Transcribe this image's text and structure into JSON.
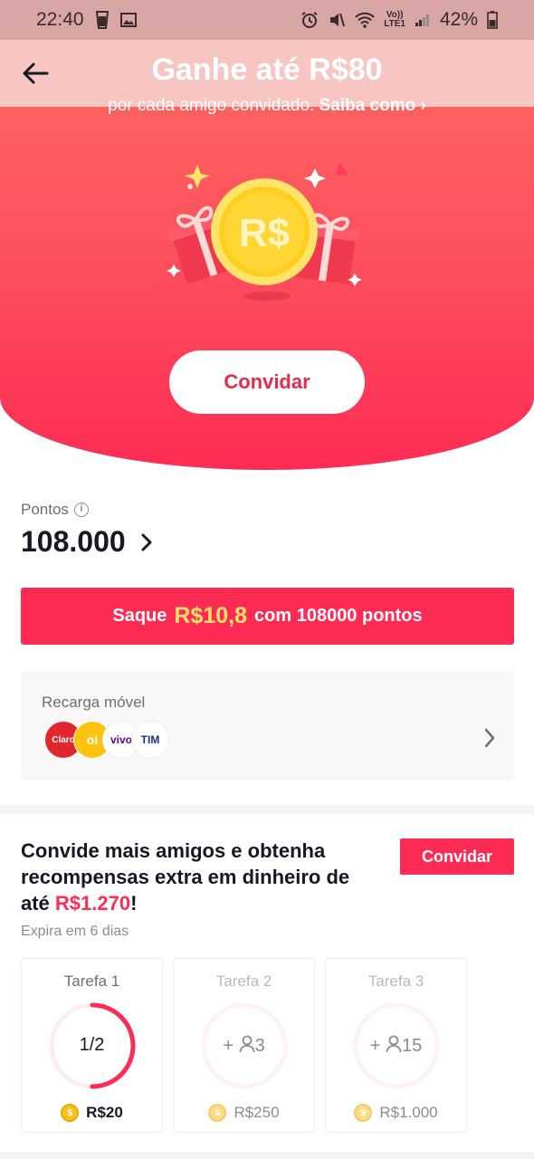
{
  "status_bar": {
    "time": "22:40",
    "battery": "42%",
    "network_label_top": "Vo))",
    "network_label_bottom": "LTE1"
  },
  "header": {
    "title": "Ganhe até R$80",
    "subtitle": "por cada amigo convidado.",
    "learn_more": "Saiba como",
    "invite_button": "Convidar"
  },
  "points": {
    "label": "Pontos",
    "value": "108.000"
  },
  "withdraw": {
    "prefix": "Saque",
    "amount": "R$10,8",
    "suffix": "com 108000 pontos"
  },
  "recharge": {
    "title": "Recarga móvel",
    "operators": [
      "Claro",
      "oi",
      "vivo",
      "TIM"
    ]
  },
  "tasks": {
    "heading_prefix": "Convide mais amigos e obtenha recompensas extra em dinheiro de até",
    "heading_amount": "R$1.270",
    "heading_suffix": "!",
    "invite_button": "Convidar",
    "expire_text": "Expira em 6 dias",
    "items": [
      {
        "title": "Tarefa 1",
        "progress_text": "1/2",
        "progress_fraction": 0.5,
        "reward": "R$20"
      },
      {
        "title": "Tarefa 2",
        "progress_text": "3",
        "progress_fraction": 0,
        "reward": "R$250"
      },
      {
        "title": "Tarefa 3",
        "progress_text": "15",
        "progress_fraction": 0,
        "reward": "R$1.000"
      }
    ]
  },
  "colors": {
    "accent": "#fe2c55",
    "hero_top": "#fb6a62",
    "gold": "#ffe16a"
  },
  "icons": {
    "back": "arrow-left-icon",
    "info": "info-icon",
    "chevron": "chevron-right-icon",
    "coin": "coin-icon",
    "person": "person-icon"
  }
}
